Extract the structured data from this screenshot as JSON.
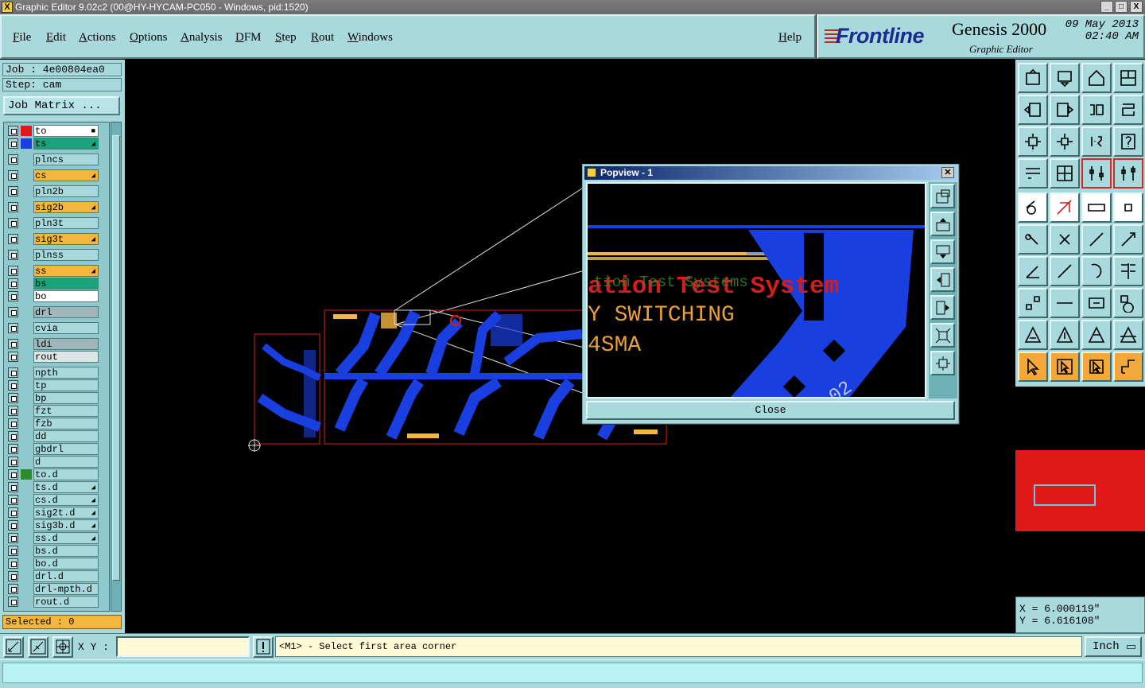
{
  "window": {
    "title": "Graphic Editor 9.02c2 (00@HY-HYCAM-PC050 - Windows, pid:1520)",
    "controls": [
      "_",
      "□",
      "X"
    ]
  },
  "menu": {
    "items": [
      "File",
      "Edit",
      "Actions",
      "Options",
      "Analysis",
      "DFM",
      "Step",
      "Rout",
      "Windows"
    ],
    "help": "Help"
  },
  "brand": {
    "logo": "Frontline",
    "product": "Genesis 2000",
    "subtitle": "Graphic Editor",
    "date": "09 May 2013",
    "time": "02:40 AM"
  },
  "job": {
    "job_line": "Job : 4e00804ea0",
    "step_line": "Step: cam",
    "matrix_button": "Job Matrix ..."
  },
  "layers": [
    {
      "name": "to",
      "swatch": "#e01818",
      "color": "#ffffff",
      "mark": "■"
    },
    {
      "name": "ts",
      "swatch": "#1a3fe0",
      "color": "#1aa37a",
      "mark": "◢"
    },
    {
      "name": "plncs",
      "swatch": "",
      "color": "#a8d9dd",
      "mark": ""
    },
    {
      "name": "cs",
      "swatch": "",
      "color": "#f5b63d",
      "mark": "◢"
    },
    {
      "name": "pln2b",
      "swatch": "",
      "color": "#a8d9dd",
      "mark": ""
    },
    {
      "name": "sig2b",
      "swatch": "",
      "color": "#f5b63d",
      "mark": "◢"
    },
    {
      "name": "pln3t",
      "swatch": "",
      "color": "#a8d9dd",
      "mark": ""
    },
    {
      "name": "sig3t",
      "swatch": "",
      "color": "#f5b63d",
      "mark": "◢"
    },
    {
      "name": "plnss",
      "swatch": "",
      "color": "#a8d9dd",
      "mark": ""
    },
    {
      "name": "ss",
      "swatch": "",
      "color": "#f5b63d",
      "mark": "◢"
    },
    {
      "name": "bs",
      "swatch": "",
      "color": "#1aa37a",
      "mark": ""
    },
    {
      "name": "bo",
      "swatch": "",
      "color": "#ffffff",
      "mark": ""
    },
    {
      "name": "drl",
      "swatch": "",
      "color": "#9fb7ba",
      "mark": ""
    },
    {
      "name": "cvia",
      "swatch": "",
      "color": "#a8d9dd",
      "mark": ""
    },
    {
      "name": "ldi",
      "swatch": "",
      "color": "#9fb7ba",
      "mark": ""
    },
    {
      "name": "rout",
      "swatch": "",
      "color": "#dde5e5",
      "mark": ""
    },
    {
      "name": "npth",
      "swatch": "",
      "color": "#a8d9dd",
      "mark": ""
    },
    {
      "name": "tp",
      "swatch": "",
      "color": "#a8d9dd",
      "mark": ""
    },
    {
      "name": "bp",
      "swatch": "",
      "color": "#a8d9dd",
      "mark": ""
    },
    {
      "name": "fzt",
      "swatch": "",
      "color": "#a8d9dd",
      "mark": ""
    },
    {
      "name": "fzb",
      "swatch": "",
      "color": "#a8d9dd",
      "mark": ""
    },
    {
      "name": "dd",
      "swatch": "",
      "color": "#a8d9dd",
      "mark": ""
    },
    {
      "name": "gbdrl",
      "swatch": "",
      "color": "#a8d9dd",
      "mark": ""
    },
    {
      "name": "d",
      "swatch": "",
      "color": "#a8d9dd",
      "mark": ""
    },
    {
      "name": "to.d",
      "swatch": "#2d8a2d",
      "color": "#a8d9dd",
      "mark": ""
    },
    {
      "name": "ts.d",
      "swatch": "",
      "color": "#a8d9dd",
      "mark": "◢"
    },
    {
      "name": "cs.d",
      "swatch": "",
      "color": "#a8d9dd",
      "mark": "◢"
    },
    {
      "name": "sig2t.d",
      "swatch": "",
      "color": "#a8d9dd",
      "mark": "◢"
    },
    {
      "name": "sig3b.d",
      "swatch": "",
      "color": "#a8d9dd",
      "mark": "◢"
    },
    {
      "name": "ss.d",
      "swatch": "",
      "color": "#a8d9dd",
      "mark": "◢"
    },
    {
      "name": "bs.d",
      "swatch": "",
      "color": "#a8d9dd",
      "mark": ""
    },
    {
      "name": "bo.d",
      "swatch": "",
      "color": "#a8d9dd",
      "mark": ""
    },
    {
      "name": "drl.d",
      "swatch": "",
      "color": "#a8d9dd",
      "mark": ""
    },
    {
      "name": "drl-mpth.d",
      "swatch": "",
      "color": "#a8d9dd",
      "mark": ""
    },
    {
      "name": "rout.d",
      "swatch": "",
      "color": "#a8d9dd",
      "mark": ""
    }
  ],
  "selected": "Selected : 0",
  "popview": {
    "title": "Popview - 1",
    "close_label": "Close",
    "text_line1": "ation Test System",
    "text_line1b": "tion Test Systems",
    "text_line2": "Y SWITCHING",
    "text_line3": "4SMA",
    "text_rot": "02"
  },
  "coords": {
    "x": "X = 6.000119\"",
    "y": "Y = 6.616108\""
  },
  "status": {
    "xy_label": "X Y :",
    "xy_value": "",
    "message": "<M1> - Select first area corner",
    "unit": "Inch"
  },
  "colors": {
    "panel": "#a8d9dd",
    "copper": "#1a3fe0",
    "silk": "#f5b63d",
    "outline": "#d21e1e"
  }
}
